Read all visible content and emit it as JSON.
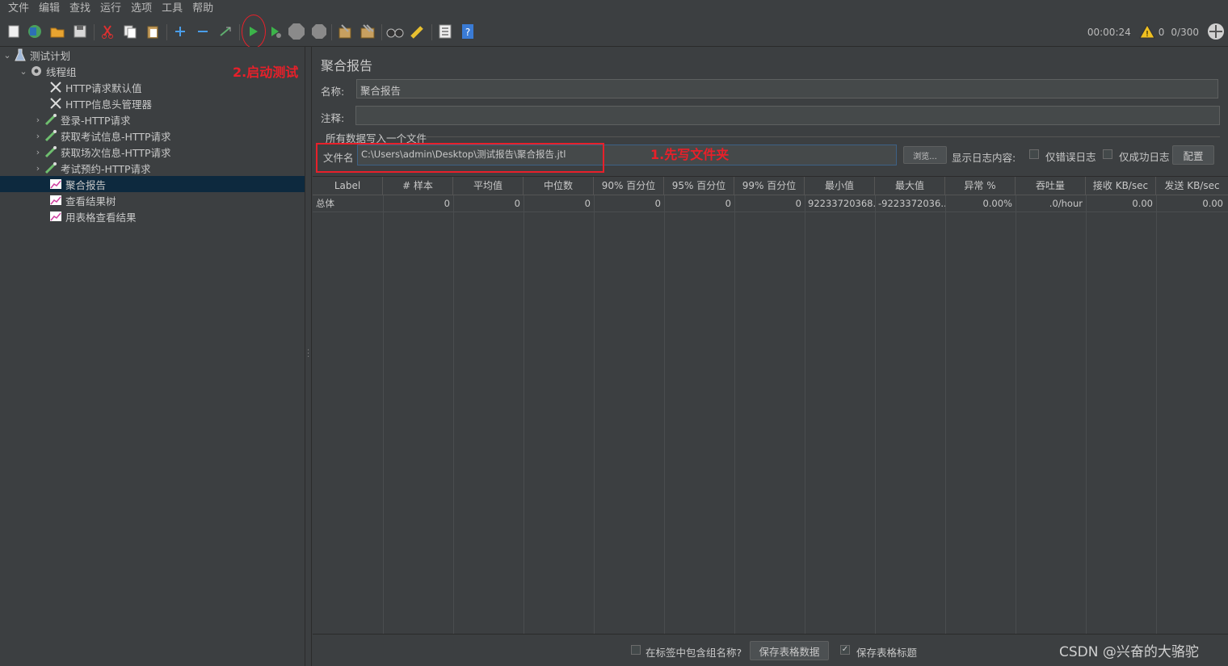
{
  "menu": [
    "文件",
    "编辑",
    "查找",
    "运行",
    "选项",
    "工具",
    "帮助"
  ],
  "toolbar": {
    "timer": "00:00:24",
    "warning_count": "0",
    "threads": "0/300"
  },
  "tree": {
    "items": [
      {
        "label": "测试计划",
        "icon": "flask-icon"
      },
      {
        "label": "线程组",
        "icon": "gear-icon"
      },
      {
        "label": "HTTP请求默认值",
        "icon": "wrench-icon"
      },
      {
        "label": "HTTP信息头管理器",
        "icon": "wrench-icon"
      },
      {
        "label": "登录-HTTP请求",
        "icon": "pipette-icon"
      },
      {
        "label": "获取考试信息-HTTP请求",
        "icon": "pipette-icon"
      },
      {
        "label": "获取场次信息-HTTP请求",
        "icon": "pipette-icon"
      },
      {
        "label": "考试预约-HTTP请求",
        "icon": "pipette-icon"
      },
      {
        "label": "聚合报告",
        "icon": "graph-icon"
      },
      {
        "label": "查看结果树",
        "icon": "graph-icon"
      },
      {
        "label": "用表格查看结果",
        "icon": "graph-icon"
      }
    ]
  },
  "panel": {
    "title": "聚合报告",
    "name_label": "名称:",
    "name_value": "聚合报告",
    "comment_label": "注释:",
    "comment_value": "",
    "file_group_title": "所有数据写入一个文件",
    "file_label": "文件名",
    "file_value": "C:\\Users\\admin\\Desktop\\测试报告\\聚合报告.jtl",
    "browse_label": "浏览...",
    "log_label": "显示日志内容:",
    "errors_only_label": "仅错误日志",
    "success_only_label": "仅成功日志",
    "config_label": "配置"
  },
  "table": {
    "headers": [
      "Label",
      "# 样本",
      "平均值",
      "中位数",
      "90% 百分位",
      "95% 百分位",
      "99% 百分位",
      "最小值",
      "最大值",
      "异常 %",
      "吞吐量",
      "接收 KB/sec",
      "发送 KB/sec"
    ],
    "rows": [
      [
        "总体",
        "0",
        "0",
        "0",
        "0",
        "0",
        "0",
        "92233720368...",
        "-9223372036...",
        "0.00%",
        ".0/hour",
        "0.00",
        "0.00"
      ]
    ]
  },
  "bottom": {
    "include_group_label": "在标签中包含组名称?",
    "save_data_label": "保存表格数据",
    "save_header_label": "保存表格标题",
    "save_header_checked": true
  },
  "annotations": {
    "step1": "1.先写文件夹",
    "step2": "2.启动测试"
  },
  "watermark": "CSDN @兴奋的大骆驼",
  "colors": {
    "background": "#3c3f41",
    "selected": "#0d293e",
    "annotation": "#e8202a"
  }
}
